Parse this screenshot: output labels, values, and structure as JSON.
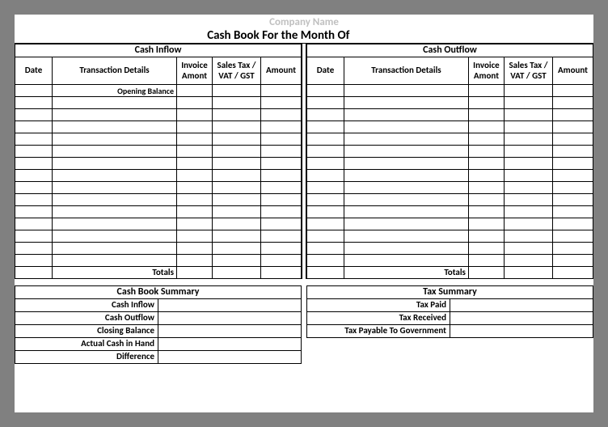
{
  "company_name": "Company Name",
  "title_prefix": "Cash Book For the Month Of",
  "title_month": "",
  "inflow": {
    "heading": "Cash Inflow",
    "columns": {
      "date": "Date",
      "details": "Transaction Details",
      "invoice": "Invoice Amont",
      "tax": "Sales Tax / VAT / GST",
      "amount": "Amount"
    },
    "opening_label": "Opening Balance",
    "totals_label": "Totals"
  },
  "outflow": {
    "heading": "Cash Outflow",
    "columns": {
      "date": "Date",
      "details": "Transaction Details",
      "invoice": "Invoice Amont",
      "tax": "Sales Tax / VAT / GST",
      "amount": "Amount"
    },
    "totals_label": "Totals"
  },
  "cashbook_summary": {
    "heading": "Cash Book Summary",
    "rows": [
      {
        "label": "Cash Inflow",
        "value": ""
      },
      {
        "label": "Cash Outflow",
        "value": ""
      },
      {
        "label": "Closing Balance",
        "value": ""
      },
      {
        "label": "Actual Cash in Hand",
        "value": ""
      },
      {
        "label": "Difference",
        "value": ""
      }
    ]
  },
  "tax_summary": {
    "heading": "Tax Summary",
    "rows": [
      {
        "label": "Tax Paid",
        "value": ""
      },
      {
        "label": "Tax Received",
        "value": ""
      },
      {
        "label": "Tax Payable To Government",
        "value": ""
      }
    ]
  }
}
